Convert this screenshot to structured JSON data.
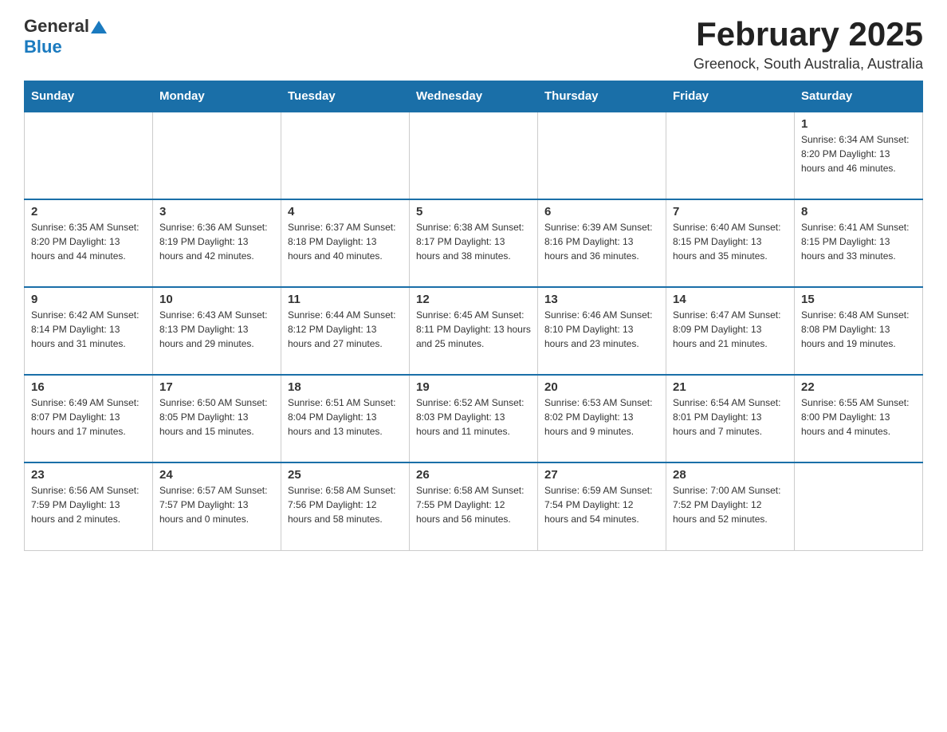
{
  "header": {
    "logo_general": "General",
    "logo_blue": "Blue",
    "title": "February 2025",
    "subtitle": "Greenock, South Australia, Australia"
  },
  "weekdays": [
    "Sunday",
    "Monday",
    "Tuesday",
    "Wednesday",
    "Thursday",
    "Friday",
    "Saturday"
  ],
  "weeks": [
    [
      {
        "day": "",
        "info": ""
      },
      {
        "day": "",
        "info": ""
      },
      {
        "day": "",
        "info": ""
      },
      {
        "day": "",
        "info": ""
      },
      {
        "day": "",
        "info": ""
      },
      {
        "day": "",
        "info": ""
      },
      {
        "day": "1",
        "info": "Sunrise: 6:34 AM\nSunset: 8:20 PM\nDaylight: 13 hours and 46 minutes."
      }
    ],
    [
      {
        "day": "2",
        "info": "Sunrise: 6:35 AM\nSunset: 8:20 PM\nDaylight: 13 hours and 44 minutes."
      },
      {
        "day": "3",
        "info": "Sunrise: 6:36 AM\nSunset: 8:19 PM\nDaylight: 13 hours and 42 minutes."
      },
      {
        "day": "4",
        "info": "Sunrise: 6:37 AM\nSunset: 8:18 PM\nDaylight: 13 hours and 40 minutes."
      },
      {
        "day": "5",
        "info": "Sunrise: 6:38 AM\nSunset: 8:17 PM\nDaylight: 13 hours and 38 minutes."
      },
      {
        "day": "6",
        "info": "Sunrise: 6:39 AM\nSunset: 8:16 PM\nDaylight: 13 hours and 36 minutes."
      },
      {
        "day": "7",
        "info": "Sunrise: 6:40 AM\nSunset: 8:15 PM\nDaylight: 13 hours and 35 minutes."
      },
      {
        "day": "8",
        "info": "Sunrise: 6:41 AM\nSunset: 8:15 PM\nDaylight: 13 hours and 33 minutes."
      }
    ],
    [
      {
        "day": "9",
        "info": "Sunrise: 6:42 AM\nSunset: 8:14 PM\nDaylight: 13 hours and 31 minutes."
      },
      {
        "day": "10",
        "info": "Sunrise: 6:43 AM\nSunset: 8:13 PM\nDaylight: 13 hours and 29 minutes."
      },
      {
        "day": "11",
        "info": "Sunrise: 6:44 AM\nSunset: 8:12 PM\nDaylight: 13 hours and 27 minutes."
      },
      {
        "day": "12",
        "info": "Sunrise: 6:45 AM\nSunset: 8:11 PM\nDaylight: 13 hours and 25 minutes."
      },
      {
        "day": "13",
        "info": "Sunrise: 6:46 AM\nSunset: 8:10 PM\nDaylight: 13 hours and 23 minutes."
      },
      {
        "day": "14",
        "info": "Sunrise: 6:47 AM\nSunset: 8:09 PM\nDaylight: 13 hours and 21 minutes."
      },
      {
        "day": "15",
        "info": "Sunrise: 6:48 AM\nSunset: 8:08 PM\nDaylight: 13 hours and 19 minutes."
      }
    ],
    [
      {
        "day": "16",
        "info": "Sunrise: 6:49 AM\nSunset: 8:07 PM\nDaylight: 13 hours and 17 minutes."
      },
      {
        "day": "17",
        "info": "Sunrise: 6:50 AM\nSunset: 8:05 PM\nDaylight: 13 hours and 15 minutes."
      },
      {
        "day": "18",
        "info": "Sunrise: 6:51 AM\nSunset: 8:04 PM\nDaylight: 13 hours and 13 minutes."
      },
      {
        "day": "19",
        "info": "Sunrise: 6:52 AM\nSunset: 8:03 PM\nDaylight: 13 hours and 11 minutes."
      },
      {
        "day": "20",
        "info": "Sunrise: 6:53 AM\nSunset: 8:02 PM\nDaylight: 13 hours and 9 minutes."
      },
      {
        "day": "21",
        "info": "Sunrise: 6:54 AM\nSunset: 8:01 PM\nDaylight: 13 hours and 7 minutes."
      },
      {
        "day": "22",
        "info": "Sunrise: 6:55 AM\nSunset: 8:00 PM\nDaylight: 13 hours and 4 minutes."
      }
    ],
    [
      {
        "day": "23",
        "info": "Sunrise: 6:56 AM\nSunset: 7:59 PM\nDaylight: 13 hours and 2 minutes."
      },
      {
        "day": "24",
        "info": "Sunrise: 6:57 AM\nSunset: 7:57 PM\nDaylight: 13 hours and 0 minutes."
      },
      {
        "day": "25",
        "info": "Sunrise: 6:58 AM\nSunset: 7:56 PM\nDaylight: 12 hours and 58 minutes."
      },
      {
        "day": "26",
        "info": "Sunrise: 6:58 AM\nSunset: 7:55 PM\nDaylight: 12 hours and 56 minutes."
      },
      {
        "day": "27",
        "info": "Sunrise: 6:59 AM\nSunset: 7:54 PM\nDaylight: 12 hours and 54 minutes."
      },
      {
        "day": "28",
        "info": "Sunrise: 7:00 AM\nSunset: 7:52 PM\nDaylight: 12 hours and 52 minutes."
      },
      {
        "day": "",
        "info": ""
      }
    ]
  ]
}
